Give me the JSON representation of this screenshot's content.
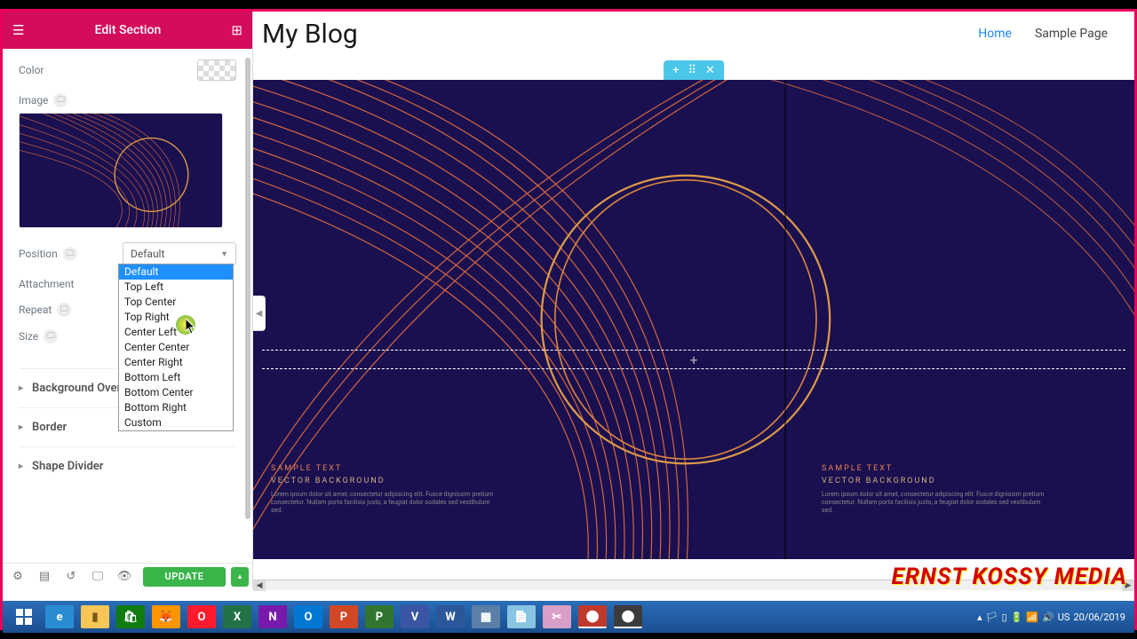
{
  "panel": {
    "title": "Edit Section",
    "color_label": "Color",
    "image_label": "Image",
    "position_label": "Position",
    "position_value": "Default",
    "attachment_label": "Attachment",
    "repeat_label": "Repeat",
    "size_label": "Size",
    "dropdown_options": [
      "Default",
      "Top Left",
      "Top Center",
      "Top Right",
      "Center Left",
      "Center Center",
      "Center Right",
      "Bottom Left",
      "Bottom Center",
      "Bottom Right",
      "Custom"
    ],
    "accordion": {
      "overlay": "Background Overlay",
      "border": "Border",
      "shape": "Shape Divider"
    },
    "update": "UPDATE"
  },
  "site": {
    "title": "My Blog",
    "nav_home": "Home",
    "nav_sample": "Sample Page"
  },
  "hero": {
    "sample": "SAMPLE TEXT",
    "vector": "VECTOR BACKGROUND",
    "lorem": "Lorem ipsum dolor sit amet, consectetur adipiscing elit. Fusce dignissim pretium consectetur. Nullam porta facilisis justo, a feugiat dolor sodales sed vestibulum sed."
  },
  "watermark": "ERNST KOSSY MEDIA",
  "taskbar": {
    "lang": "US",
    "date": "20/06/2019"
  }
}
